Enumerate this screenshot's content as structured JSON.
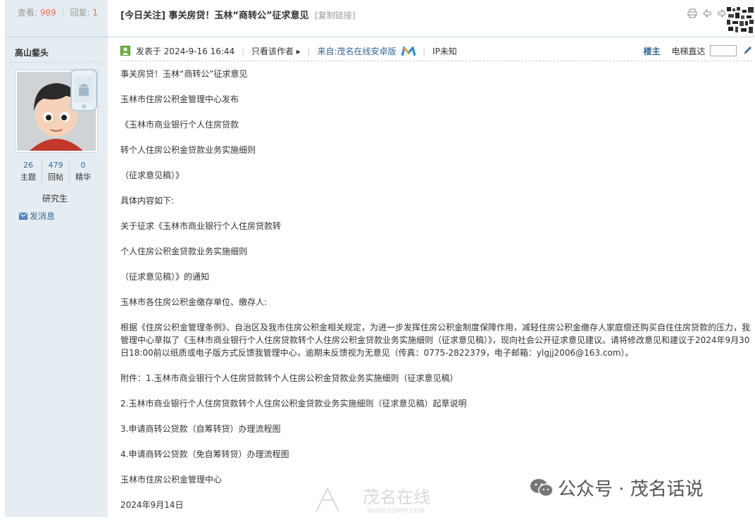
{
  "stats": {
    "views_label": "查看:",
    "views": "989",
    "replies_label": "回复:",
    "replies": "1",
    "separator": "|"
  },
  "thread": {
    "title": "[今日关注] 事关房贷！玉林“商转公”征求意见",
    "copy_link": "[复制链接]"
  },
  "author": {
    "name": "高山錖头",
    "stats": [
      {
        "value": "26",
        "label": "主题"
      },
      {
        "value": "479",
        "label": "回帖"
      },
      {
        "value": "0",
        "label": "精华"
      }
    ],
    "rank": "研究生",
    "send_message": "发消息"
  },
  "post_meta": {
    "posted_prefix": "发表于",
    "posted_time": "2024-9-16 16:44",
    "only_author": "只看该作者",
    "source": "来自:茂名在线安卓版",
    "ip": "IP未知",
    "floor": "楼主",
    "elevator": "电梯直达"
  },
  "content": [
    "事关房贷！玉林“商转公”征求意见",
    "玉林市住房公积金管理中心发布",
    "《玉林市商业银行个人住房贷款",
    "转个人住房公积金贷款业务实施细则",
    "（征求意见稿）》",
    "具体内容如下:",
    "关于征求《玉林市商业银行个人住房贷款转",
    "个人住房公积金贷款业务实施细则",
    "（征求意见稿）》的通知",
    "玉林市各住房公积金缴存单位、缴存人:"
  ],
  "content_para": "根据《住房公积金管理条例》、自治区及我市住房公积金相关规定，为进一步发挥住房公积金制度保障作用，减轻住房公积金缴存人家庭偿还购买自住住房贷款的压力，我管理中心草拟了《玉林市商业银行个人住房贷款转个人住房公积金贷款业务实施细则（征求意见稿）》，现向社会公开征求意见建议。请将修改意见和建议于2024年9月30日18:00前以纸质或电子版方式反馈我管理中心，逾期未反馈视为无意见（传真：0775-2822379，电子邮箱：ylgjj2006@163.com）。",
  "content_tail": [
    "附件：1.玉林市商业银行个人住房贷款转个人住房公积金贷款业务实施细则（征求意见稿）",
    "2.玉林市商业银行个人住房贷款转个人住房公积金贷款业务实施细则（征求意见稿）起草说明",
    "3.申请商转公贷款（自筹转贷）办理流程图",
    "4.申请商转公贷款（免自筹转贷）办理流程图",
    "玉林市住房公积金管理中心",
    "2024年9月14日"
  ],
  "watermark": {
    "wechat": "公众号 · 茂名话说",
    "gdmm_main": "茂名在线",
    "gdmm_url": "WWW.GDMM.COM"
  },
  "colors": {
    "sidebar": "#e5edf2",
    "border": "#c2d5e3",
    "link": "#369",
    "accent": "#f26c4f"
  }
}
